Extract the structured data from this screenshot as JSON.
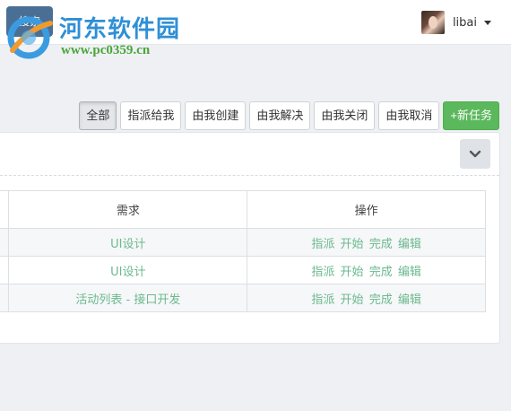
{
  "header": {
    "search_label": "搜索",
    "user": {
      "name": "libai"
    }
  },
  "watermark": {
    "title": "河东软件园",
    "url": "www.pc0359.cn"
  },
  "toolbar": {
    "filters": [
      {
        "label": "全部",
        "active": true
      },
      {
        "label": "指派给我"
      },
      {
        "label": "由我创建"
      },
      {
        "label": "由我解决"
      },
      {
        "label": "由我关闭"
      },
      {
        "label": "由我取消"
      }
    ],
    "new_task_label": "+新任务"
  },
  "table": {
    "columns": [
      "需求",
      "操作"
    ],
    "rows": [
      {
        "requirement": "UI设计",
        "actions": [
          "指派",
          "开始",
          "完成",
          "编辑"
        ]
      },
      {
        "requirement": "UI设计",
        "actions": [
          "指派",
          "开始",
          "完成",
          "编辑"
        ]
      },
      {
        "requirement": "活动列表 - 接口开发",
        "actions": [
          "指派",
          "开始",
          "完成",
          "编辑"
        ]
      }
    ]
  },
  "colors": {
    "link": "#6cb98f",
    "primary": "#5cb85c",
    "navbar_button": "#4a6f94"
  }
}
